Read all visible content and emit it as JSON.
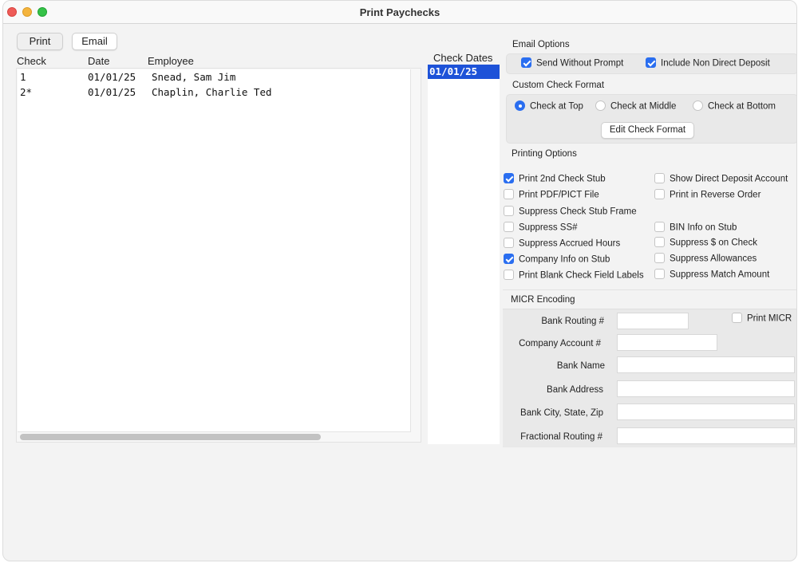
{
  "window": {
    "title": "Print Paychecks",
    "controls": [
      "close",
      "minimize",
      "zoom"
    ]
  },
  "toolbar": {
    "print_label": "Print",
    "email_label": "Email"
  },
  "checks_table": {
    "columns": [
      "Check",
      "Date",
      "Employee"
    ],
    "rows": [
      {
        "check": "1",
        "date": "01/01/25",
        "employee": "Snead, Sam Jim"
      },
      {
        "check": "2*",
        "date": "01/01/25",
        "employee": "Chaplin, Charlie Ted"
      }
    ]
  },
  "check_dates": {
    "header": "Check Dates",
    "items": [
      "01/01/25"
    ],
    "selected": "01/01/25"
  },
  "email_options": {
    "label": "Email Options",
    "items": [
      {
        "label": "Send Without Prompt",
        "checked": true
      },
      {
        "label": "Include Non Direct Deposit",
        "checked": true
      }
    ]
  },
  "custom_check_format": {
    "label": "Custom Check Format",
    "options": [
      {
        "label": "Check at Top",
        "selected": true
      },
      {
        "label": "Check at Middle",
        "selected": false
      },
      {
        "label": "Check at Bottom",
        "selected": false
      }
    ],
    "edit_button": "Edit Check Format"
  },
  "printing_options": {
    "label": "Printing Options",
    "left": [
      {
        "label": "Print 2nd Check Stub",
        "checked": true
      },
      {
        "label": "Print PDF/PICT File",
        "checked": false
      },
      {
        "label": "Suppress Check Stub Frame",
        "checked": false
      },
      {
        "label": "Suppress SS#",
        "checked": false
      },
      {
        "label": "Suppress Accrued Hours",
        "checked": false
      },
      {
        "label": "Company Info on Stub",
        "checked": true
      },
      {
        "label": "Print Blank Check Field Labels",
        "checked": false
      }
    ],
    "right": [
      {
        "label": "Show Direct Deposit Account",
        "checked": false
      },
      {
        "label": "Print in Reverse Order",
        "checked": false
      },
      {
        "label": "BIN Info on Stub",
        "checked": false
      },
      {
        "label": "Suppress $ on Check",
        "checked": false
      },
      {
        "label": "Suppress Allowances",
        "checked": false
      },
      {
        "label": "Suppress Match Amount",
        "checked": false
      }
    ]
  },
  "micr_encoding": {
    "label": "MICR Encoding",
    "print_micr": {
      "label": "Print MICR",
      "checked": false
    },
    "fields": [
      {
        "label": "Bank Routing #",
        "value": ""
      },
      {
        "label": "Company Account #",
        "value": ""
      },
      {
        "label": "Bank Name",
        "value": ""
      },
      {
        "label": "Bank Address",
        "value": ""
      },
      {
        "label": "Bank City, State, Zip",
        "value": ""
      },
      {
        "label": "Fractional Routing #",
        "value": ""
      }
    ]
  },
  "colors": {
    "accent": "#2a6ef0",
    "selection": "#1d52d8",
    "window_bg": "#f3f3f3"
  }
}
